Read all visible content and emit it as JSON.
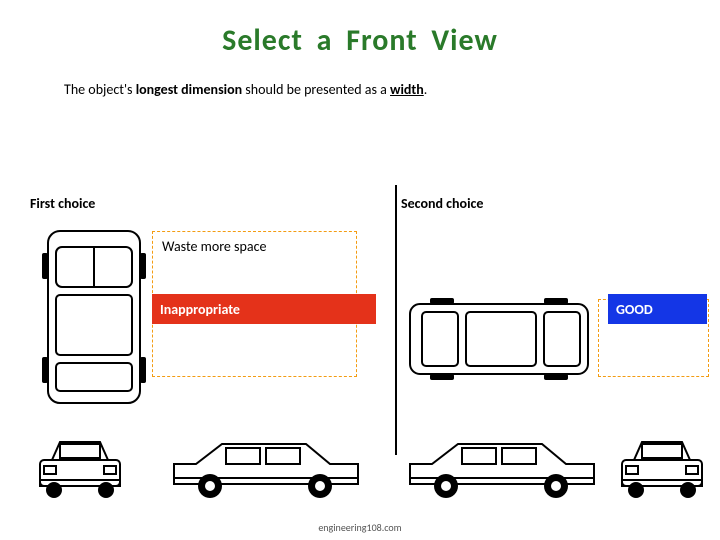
{
  "title": "Select  a  Front  View",
  "subtitle": {
    "pre": "The object's ",
    "bold": "longest dimension",
    "mid": " should be presented as a ",
    "emph": "width",
    "post": "."
  },
  "labels": {
    "first": "First choice",
    "second": "Second choice",
    "waste": "Waste more space",
    "inappropriate": "Inappropriate",
    "good": "GOOD"
  },
  "footer": "engineering108.com",
  "colors": {
    "title": "#2a7a2a",
    "dash": "#f39c12",
    "bad": "#e4321a",
    "good": "#1436e6"
  }
}
